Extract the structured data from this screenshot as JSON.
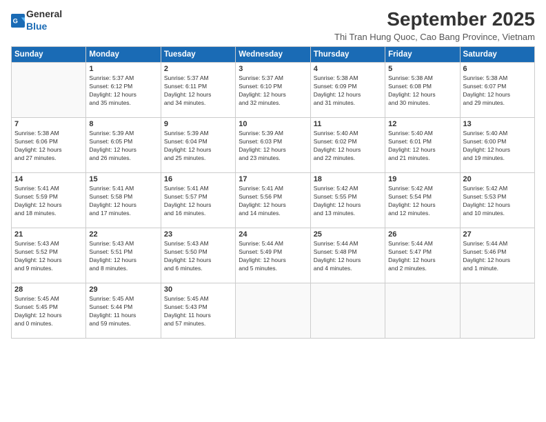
{
  "logo": {
    "general": "General",
    "blue": "Blue"
  },
  "title": "September 2025",
  "subtitle": "Thi Tran Hung Quoc, Cao Bang Province, Vietnam",
  "headers": [
    "Sunday",
    "Monday",
    "Tuesday",
    "Wednesday",
    "Thursday",
    "Friday",
    "Saturday"
  ],
  "weeks": [
    [
      {
        "day": "",
        "info": ""
      },
      {
        "day": "1",
        "info": "Sunrise: 5:37 AM\nSunset: 6:12 PM\nDaylight: 12 hours\nand 35 minutes."
      },
      {
        "day": "2",
        "info": "Sunrise: 5:37 AM\nSunset: 6:11 PM\nDaylight: 12 hours\nand 34 minutes."
      },
      {
        "day": "3",
        "info": "Sunrise: 5:37 AM\nSunset: 6:10 PM\nDaylight: 12 hours\nand 32 minutes."
      },
      {
        "day": "4",
        "info": "Sunrise: 5:38 AM\nSunset: 6:09 PM\nDaylight: 12 hours\nand 31 minutes."
      },
      {
        "day": "5",
        "info": "Sunrise: 5:38 AM\nSunset: 6:08 PM\nDaylight: 12 hours\nand 30 minutes."
      },
      {
        "day": "6",
        "info": "Sunrise: 5:38 AM\nSunset: 6:07 PM\nDaylight: 12 hours\nand 29 minutes."
      }
    ],
    [
      {
        "day": "7",
        "info": "Sunrise: 5:38 AM\nSunset: 6:06 PM\nDaylight: 12 hours\nand 27 minutes."
      },
      {
        "day": "8",
        "info": "Sunrise: 5:39 AM\nSunset: 6:05 PM\nDaylight: 12 hours\nand 26 minutes."
      },
      {
        "day": "9",
        "info": "Sunrise: 5:39 AM\nSunset: 6:04 PM\nDaylight: 12 hours\nand 25 minutes."
      },
      {
        "day": "10",
        "info": "Sunrise: 5:39 AM\nSunset: 6:03 PM\nDaylight: 12 hours\nand 23 minutes."
      },
      {
        "day": "11",
        "info": "Sunrise: 5:40 AM\nSunset: 6:02 PM\nDaylight: 12 hours\nand 22 minutes."
      },
      {
        "day": "12",
        "info": "Sunrise: 5:40 AM\nSunset: 6:01 PM\nDaylight: 12 hours\nand 21 minutes."
      },
      {
        "day": "13",
        "info": "Sunrise: 5:40 AM\nSunset: 6:00 PM\nDaylight: 12 hours\nand 19 minutes."
      }
    ],
    [
      {
        "day": "14",
        "info": "Sunrise: 5:41 AM\nSunset: 5:59 PM\nDaylight: 12 hours\nand 18 minutes."
      },
      {
        "day": "15",
        "info": "Sunrise: 5:41 AM\nSunset: 5:58 PM\nDaylight: 12 hours\nand 17 minutes."
      },
      {
        "day": "16",
        "info": "Sunrise: 5:41 AM\nSunset: 5:57 PM\nDaylight: 12 hours\nand 16 minutes."
      },
      {
        "day": "17",
        "info": "Sunrise: 5:41 AM\nSunset: 5:56 PM\nDaylight: 12 hours\nand 14 minutes."
      },
      {
        "day": "18",
        "info": "Sunrise: 5:42 AM\nSunset: 5:55 PM\nDaylight: 12 hours\nand 13 minutes."
      },
      {
        "day": "19",
        "info": "Sunrise: 5:42 AM\nSunset: 5:54 PM\nDaylight: 12 hours\nand 12 minutes."
      },
      {
        "day": "20",
        "info": "Sunrise: 5:42 AM\nSunset: 5:53 PM\nDaylight: 12 hours\nand 10 minutes."
      }
    ],
    [
      {
        "day": "21",
        "info": "Sunrise: 5:43 AM\nSunset: 5:52 PM\nDaylight: 12 hours\nand 9 minutes."
      },
      {
        "day": "22",
        "info": "Sunrise: 5:43 AM\nSunset: 5:51 PM\nDaylight: 12 hours\nand 8 minutes."
      },
      {
        "day": "23",
        "info": "Sunrise: 5:43 AM\nSunset: 5:50 PM\nDaylight: 12 hours\nand 6 minutes."
      },
      {
        "day": "24",
        "info": "Sunrise: 5:44 AM\nSunset: 5:49 PM\nDaylight: 12 hours\nand 5 minutes."
      },
      {
        "day": "25",
        "info": "Sunrise: 5:44 AM\nSunset: 5:48 PM\nDaylight: 12 hours\nand 4 minutes."
      },
      {
        "day": "26",
        "info": "Sunrise: 5:44 AM\nSunset: 5:47 PM\nDaylight: 12 hours\nand 2 minutes."
      },
      {
        "day": "27",
        "info": "Sunrise: 5:44 AM\nSunset: 5:46 PM\nDaylight: 12 hours\nand 1 minute."
      }
    ],
    [
      {
        "day": "28",
        "info": "Sunrise: 5:45 AM\nSunset: 5:45 PM\nDaylight: 12 hours\nand 0 minutes."
      },
      {
        "day": "29",
        "info": "Sunrise: 5:45 AM\nSunset: 5:44 PM\nDaylight: 11 hours\nand 59 minutes."
      },
      {
        "day": "30",
        "info": "Sunrise: 5:45 AM\nSunset: 5:43 PM\nDaylight: 11 hours\nand 57 minutes."
      },
      {
        "day": "",
        "info": ""
      },
      {
        "day": "",
        "info": ""
      },
      {
        "day": "",
        "info": ""
      },
      {
        "day": "",
        "info": ""
      }
    ]
  ]
}
